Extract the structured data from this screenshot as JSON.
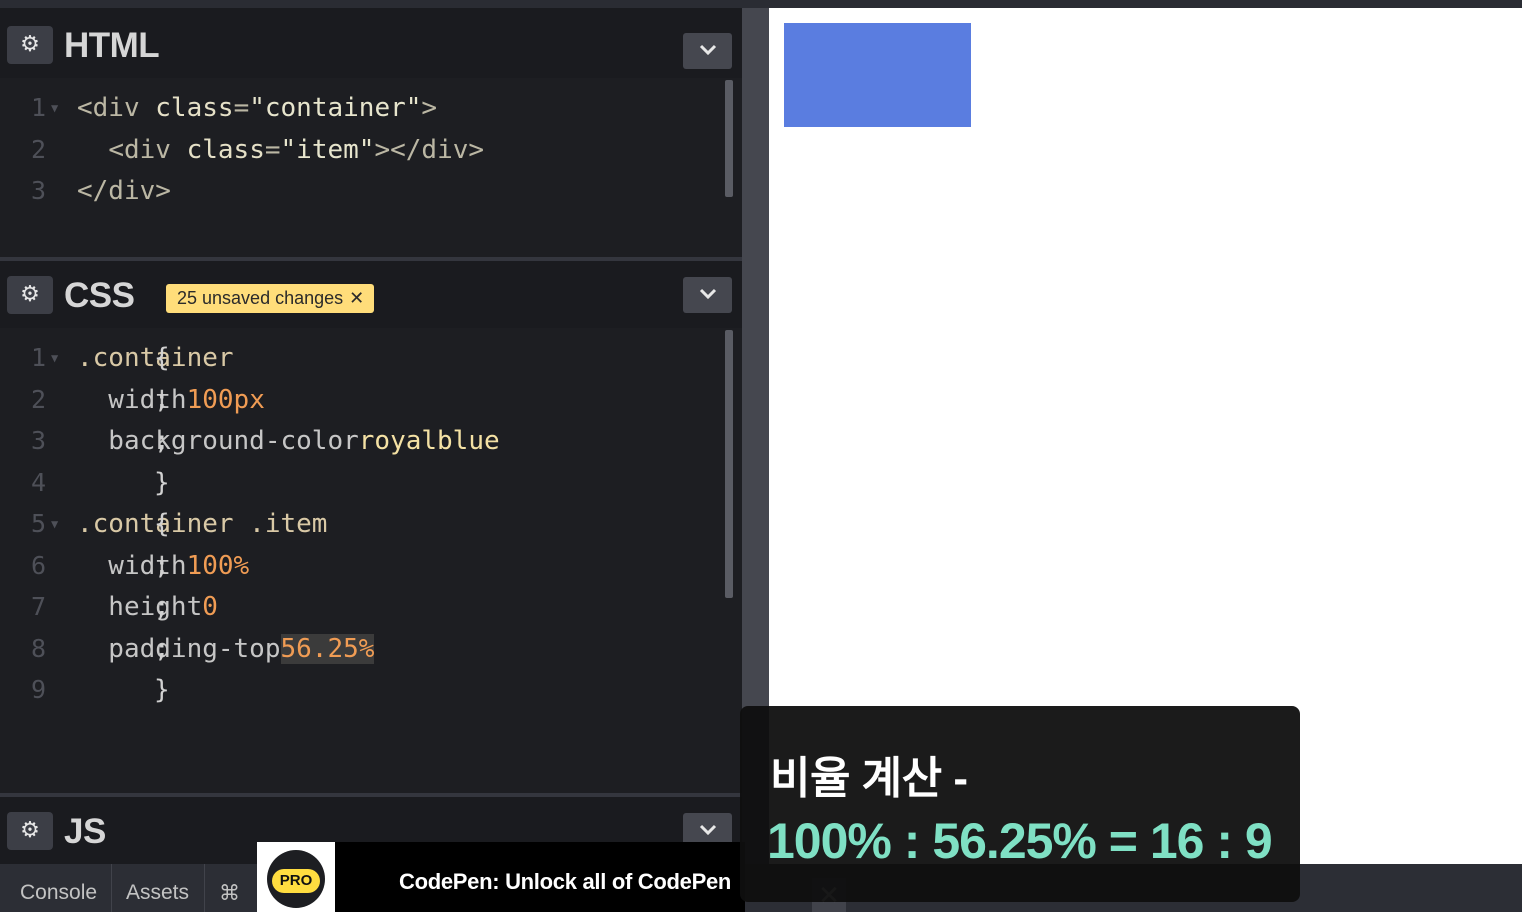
{
  "panes": {
    "html": {
      "title": "HTML",
      "settings_icon": "gear-icon",
      "collapse_icon": "chevron-down-icon",
      "lines": [
        {
          "n": "1",
          "t": [
            [
              "tag",
              "<div "
            ],
            [
              "attr",
              "class"
            ],
            [
              "tag",
              "="
            ],
            [
              "str",
              "\"container\""
            ],
            [
              "tag",
              ">"
            ]
          ]
        },
        {
          "n": "2",
          "t": [
            [
              "tag",
              "  "
            ],
            [
              "tag",
              "<div "
            ],
            [
              "attr",
              "class"
            ],
            [
              "tag",
              "="
            ],
            [
              "str",
              "\"item\""
            ],
            [
              "tag",
              "></div>"
            ]
          ]
        },
        {
          "n": "3",
          "t": [
            [
              "tag",
              "</div>"
            ]
          ]
        }
      ]
    },
    "css": {
      "title": "CSS",
      "unsaved_badge": "25 unsaved changes",
      "badge_close": "✕",
      "settings_icon": "gear-icon",
      "collapse_icon": "chevron-down-icon",
      "lines": [
        {
          "n": "1",
          "t": [
            [
              "sel",
              ".container "
            ],
            [
              "code",
              "{"
            ]
          ]
        },
        {
          "n": "2",
          "t": [
            [
              "prop",
              "  width"
            ],
            [
              "code",
              ": "
            ],
            [
              "num",
              "100px"
            ],
            [
              "code",
              ";"
            ]
          ]
        },
        {
          "n": "3",
          "t": [
            [
              "prop",
              "  background-color"
            ],
            [
              "code",
              ": "
            ],
            [
              "kw",
              "royalblue"
            ],
            [
              "code",
              ";"
            ]
          ]
        },
        {
          "n": "4",
          "t": [
            [
              "code",
              "}"
            ]
          ]
        },
        {
          "n": "5",
          "t": [
            [
              "sel",
              ".container .item "
            ],
            [
              "code",
              "{"
            ]
          ]
        },
        {
          "n": "6",
          "t": [
            [
              "prop",
              "  width"
            ],
            [
              "code",
              ": "
            ],
            [
              "num",
              "100%"
            ],
            [
              "code",
              ";"
            ]
          ]
        },
        {
          "n": "7",
          "t": [
            [
              "prop",
              "  height"
            ],
            [
              "code",
              ": "
            ],
            [
              "num",
              "0"
            ],
            [
              "code",
              ";"
            ]
          ]
        },
        {
          "n": "8",
          "t": [
            [
              "prop",
              "  padding-top"
            ],
            [
              "code",
              ": "
            ],
            [
              "numhl",
              "56.25%"
            ],
            [
              "code",
              ";"
            ]
          ]
        },
        {
          "n": "9",
          "t": [
            [
              "code",
              "}"
            ]
          ]
        }
      ]
    },
    "js": {
      "title": "JS",
      "settings_icon": "gear-icon",
      "collapse_icon": "chevron-down-icon"
    }
  },
  "footer": {
    "console": "Console",
    "assets": "Assets",
    "shortcuts": "⌘",
    "pro_label": "PRO",
    "promo_text": "CodePen: Unlock all of CodePen",
    "close": "✕"
  },
  "preview": {
    "box_color": "#5a7de0"
  },
  "caption": {
    "line1": "비율 계산 -",
    "line2": "100% : 56.25% = 16 : 9"
  }
}
